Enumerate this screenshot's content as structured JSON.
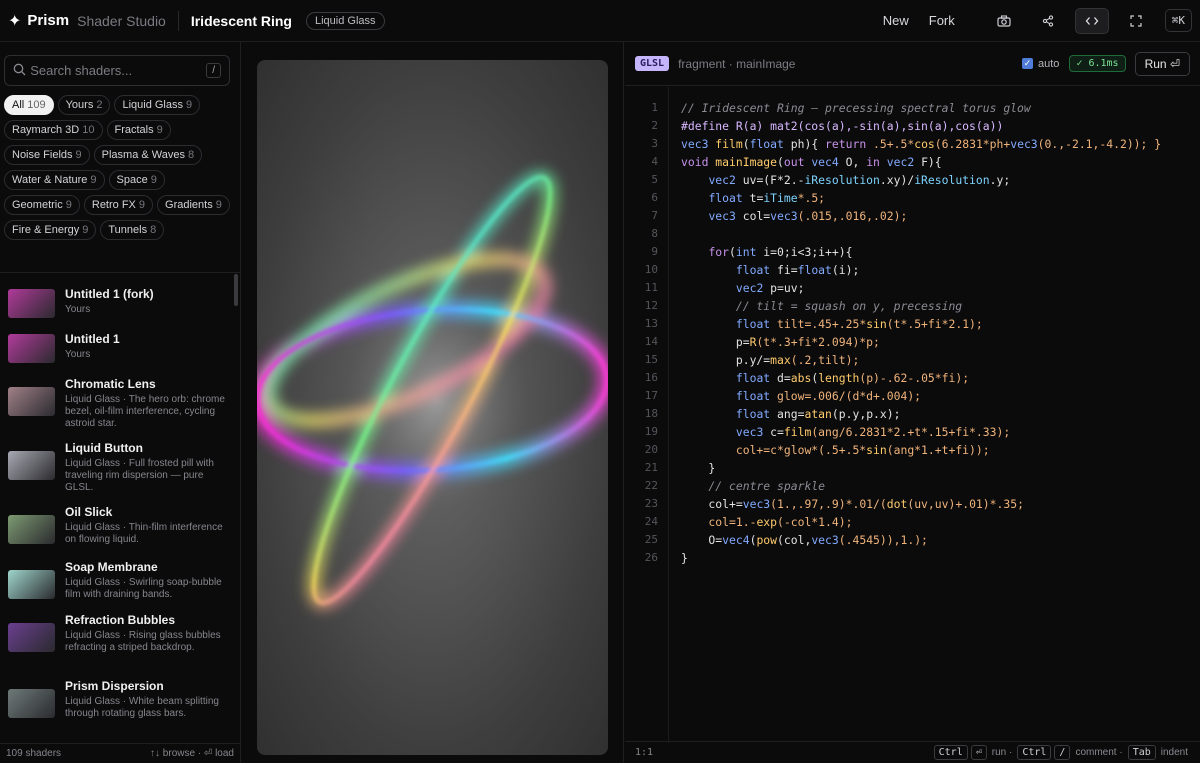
{
  "app": {
    "logo_glyph": "✦",
    "name": "Prism",
    "subtitle": "Shader Studio"
  },
  "shader": {
    "title": "Iridescent Ring",
    "category": "Liquid Glass"
  },
  "toolbar": {
    "new_label": "New",
    "fork_label": "Fork",
    "shortcut_label": "⌘K",
    "icons": [
      "camera-icon",
      "share-icon",
      "code-icon",
      "fullscreen-icon"
    ]
  },
  "search": {
    "placeholder": "Search shaders...",
    "shortcut": "/"
  },
  "filters": [
    {
      "label": "All",
      "count": "109",
      "active": true
    },
    {
      "label": "Yours",
      "count": "2"
    },
    {
      "label": "Liquid Glass",
      "count": "9"
    },
    {
      "label": "Raymarch 3D",
      "count": "10"
    },
    {
      "label": "Fractals",
      "count": "9"
    },
    {
      "label": "Noise Fields",
      "count": "9"
    },
    {
      "label": "Plasma & Waves",
      "count": "8"
    },
    {
      "label": "Water & Nature",
      "count": "9"
    },
    {
      "label": "Space",
      "count": "9"
    },
    {
      "label": "Geometric",
      "count": "9"
    },
    {
      "label": "Retro FX",
      "count": "9"
    },
    {
      "label": "Gradients",
      "count": "9"
    },
    {
      "label": "Fire & Energy",
      "count": "9"
    },
    {
      "label": "Tunnels",
      "count": "8"
    }
  ],
  "shaders": [
    {
      "title": "Untitled 1 (fork)",
      "desc": "Yours",
      "thumb": "#b13a9a"
    },
    {
      "title": "Untitled 1",
      "desc": "Yours",
      "thumb": "#b23b9b"
    },
    {
      "title": "Chromatic Lens",
      "desc": "Liquid Glass · The hero orb: chrome bezel, oil-film interference, cycling astroid star.",
      "thumb": "#a08088"
    },
    {
      "title": "Liquid Button",
      "desc": "Liquid Glass · Full frosted pill with traveling rim dispersion — pure GLSL.",
      "thumb": "#a9a9b3"
    },
    {
      "title": "Oil Slick",
      "desc": "Liquid Glass · Thin-film interference on flowing liquid.",
      "thumb": "#7d9a72"
    },
    {
      "title": "Soap Membrane",
      "desc": "Liquid Glass · Swirling soap-bubble film with draining bands.",
      "thumb": "#9fd6cc"
    },
    {
      "title": "Refraction Bubbles",
      "desc": "Liquid Glass · Rising glass bubbles refracting a striped backdrop.",
      "thumb": "#6a3f8f"
    },
    {
      "title": "Prism Dispersion",
      "desc": "Liquid Glass · White beam splitting through rotating glass bars.",
      "thumb": "#6e7a78"
    }
  ],
  "sidebar_footer": {
    "count": "109 shaders",
    "hints": "↑↓ browse · ⏎ load"
  },
  "editor": {
    "lang_badge": "GLSL",
    "path": "fragment · mainImage",
    "auto_label": "auto",
    "auto_checked": true,
    "timing": "✓ 6.1ms",
    "run_label": "Run ⏎",
    "cursor": "1:1",
    "lines": [
      [
        [
          "// Iridescent Ring — precessing spectral torus glow",
          "c"
        ]
      ],
      [
        [
          "#define R(a) mat2(cos(a),-sin(a),sin(a),cos(a))",
          "p"
        ]
      ],
      [
        [
          "vec3 ",
          "t"
        ],
        [
          "film",
          "f"
        ],
        [
          "(",
          ""
        ],
        [
          "float",
          "t"
        ],
        [
          " ph){ ",
          ""
        ],
        [
          "return",
          "k"
        ],
        [
          " .5+.5*",
          "n"
        ],
        [
          "cos",
          "f"
        ],
        [
          "(6.2831*ph+",
          "n"
        ],
        [
          "vec3",
          "t"
        ],
        [
          "(0.,-2.1,-4.2)); }",
          "n"
        ]
      ],
      [
        [
          "void",
          "k"
        ],
        [
          " ",
          ""
        ],
        [
          "mainImage",
          "f"
        ],
        [
          "(",
          ""
        ],
        [
          "out",
          "k"
        ],
        [
          " ",
          ""
        ],
        [
          "vec4",
          "t"
        ],
        [
          " O, ",
          ""
        ],
        [
          "in",
          "k"
        ],
        [
          " ",
          ""
        ],
        [
          "vec2",
          "t"
        ],
        [
          " F){",
          ""
        ]
      ],
      [
        [
          "    ",
          ""
        ],
        [
          "vec2",
          "t"
        ],
        [
          " uv=(F*2.-",
          ""
        ],
        [
          "iResolution",
          "v"
        ],
        [
          ".xy)/",
          ""
        ],
        [
          "iResolution",
          "v"
        ],
        [
          ".y;",
          ""
        ]
      ],
      [
        [
          "    ",
          ""
        ],
        [
          "float",
          "t"
        ],
        [
          " t=",
          ""
        ],
        [
          "iTime",
          "v"
        ],
        [
          "*.5;",
          "n"
        ]
      ],
      [
        [
          "    ",
          ""
        ],
        [
          "vec3",
          "t"
        ],
        [
          " col=",
          ""
        ],
        [
          "vec3",
          "t"
        ],
        [
          "(.015,.016,.02);",
          "n"
        ]
      ],
      [
        [
          "",
          ""
        ]
      ],
      [
        [
          "    ",
          ""
        ],
        [
          "for",
          "k"
        ],
        [
          "(",
          ""
        ],
        [
          "int",
          "t"
        ],
        [
          " i=0;i<3;i++){",
          ""
        ]
      ],
      [
        [
          "        ",
          ""
        ],
        [
          "float",
          "t"
        ],
        [
          " fi=",
          ""
        ],
        [
          "float",
          "t"
        ],
        [
          "(i);",
          ""
        ]
      ],
      [
        [
          "        ",
          ""
        ],
        [
          "vec2",
          "t"
        ],
        [
          " p=uv;",
          ""
        ]
      ],
      [
        [
          "        // tilt = squash on y, precessing",
          "c"
        ]
      ],
      [
        [
          "        ",
          ""
        ],
        [
          "float",
          "t"
        ],
        [
          " tilt=.45+.25*",
          "n"
        ],
        [
          "sin",
          "f"
        ],
        [
          "(t*.5+fi*2.1);",
          "n"
        ]
      ],
      [
        [
          "        p=",
          ""
        ],
        [
          "R",
          "f"
        ],
        [
          "(t*.3+fi*2.094)*p;",
          "n"
        ]
      ],
      [
        [
          "        p.y/=",
          ""
        ],
        [
          "max",
          "f"
        ],
        [
          "(.2,tilt);",
          "n"
        ]
      ],
      [
        [
          "        ",
          ""
        ],
        [
          "float",
          "t"
        ],
        [
          " d=",
          ""
        ],
        [
          "abs",
          "f"
        ],
        [
          "(",
          ""
        ],
        [
          "length",
          "f"
        ],
        [
          "(p)-.62-.05*fi);",
          "n"
        ]
      ],
      [
        [
          "        ",
          ""
        ],
        [
          "float",
          "t"
        ],
        [
          " glow=.006/(d*d+.004);",
          "n"
        ]
      ],
      [
        [
          "        ",
          ""
        ],
        [
          "float",
          "t"
        ],
        [
          " ang=",
          ""
        ],
        [
          "atan",
          "f"
        ],
        [
          "(p.y,p.x);",
          ""
        ]
      ],
      [
        [
          "        ",
          ""
        ],
        [
          "vec3",
          "t"
        ],
        [
          " c=",
          ""
        ],
        [
          "film",
          "f"
        ],
        [
          "(ang/6.2831*2.+t*.15+fi*.33);",
          "n"
        ]
      ],
      [
        [
          "        col+=c*glow*(.5+.5*",
          "n"
        ],
        [
          "sin",
          "f"
        ],
        [
          "(ang*1.+t+fi));",
          "n"
        ]
      ],
      [
        [
          "    }",
          ""
        ]
      ],
      [
        [
          "    // centre sparkle",
          "c"
        ]
      ],
      [
        [
          "    col+=",
          ""
        ],
        [
          "vec3",
          "t"
        ],
        [
          "(1.,.97,.9)*.01/(",
          "n"
        ],
        [
          "dot",
          "f"
        ],
        [
          "(uv,uv)+.01)*.35;",
          "n"
        ]
      ],
      [
        [
          "    col=1.-",
          "n"
        ],
        [
          "exp",
          "f"
        ],
        [
          "(-col*1.4);",
          "n"
        ]
      ],
      [
        [
          "    O=",
          ""
        ],
        [
          "vec4",
          "t"
        ],
        [
          "(",
          ""
        ],
        [
          "pow",
          "f"
        ],
        [
          "(col,",
          ""
        ],
        [
          "vec3",
          "t"
        ],
        [
          "(.4545)),1.);",
          "n"
        ]
      ],
      [
        [
          "}",
          ""
        ]
      ]
    ]
  },
  "editor_footer": {
    "keys": [
      {
        "key": "Ctrl"
      },
      {
        "key": "⏎"
      },
      {
        "text": "run ·"
      },
      {
        "key": "Ctrl"
      },
      {
        "key": "/"
      },
      {
        "text": "comment ·"
      },
      {
        "key": "Tab"
      },
      {
        "text": "indent"
      }
    ]
  },
  "colors": {
    "comment": "#8b8b93",
    "keyword": "#c792ea",
    "type": "#82aaff",
    "func": "#ffcb6b",
    "number": "#f0b37a",
    "preproc": "#d7b8ff",
    "builtin": "#7dd3fc"
  }
}
